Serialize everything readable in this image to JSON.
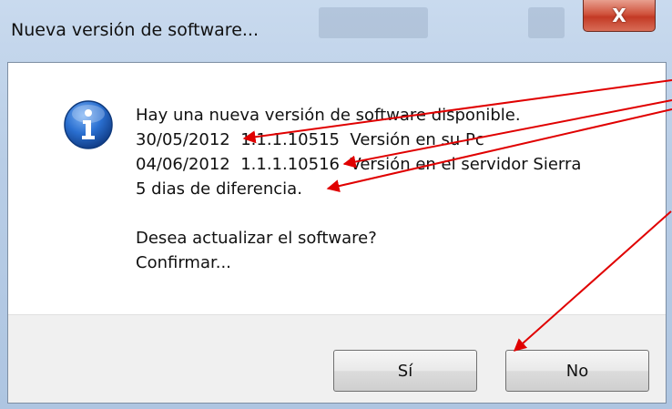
{
  "window": {
    "title": "Nueva versión de software...",
    "close_label": "X"
  },
  "dialog": {
    "icon": "info-icon",
    "lines": [
      "Hay una nueva versión de software disponible.",
      "30/05/2012  1.1.1.10515  Versión en su Pc",
      "04/06/2012  1.1.1.10516  Versión en el servidor Sierra",
      "5 dias de diferencia.",
      "",
      "Desea actualizar el software?",
      "Confirmar..."
    ]
  },
  "buttons": {
    "yes_label": "Sí",
    "no_label": "No"
  },
  "colors": {
    "annotation_arrow": "#e00000",
    "info_icon": "#1f62c4",
    "close_button": "#c94a35"
  }
}
